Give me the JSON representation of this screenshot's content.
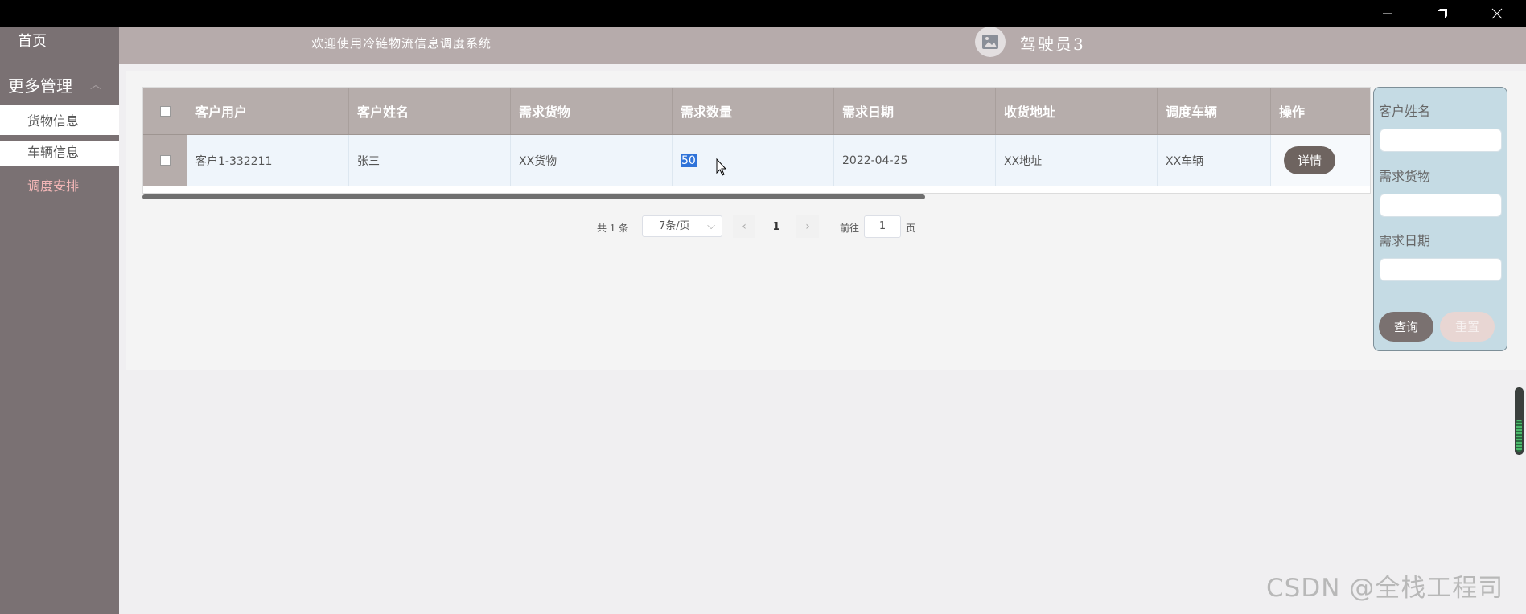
{
  "window": {
    "minimize_icon": "minimize-icon",
    "restore_icon": "restore-icon",
    "close_icon": "close-icon"
  },
  "sidebar": {
    "home": "首页",
    "group": "更多管理",
    "items": [
      {
        "label": "货物信息"
      },
      {
        "label": "车辆信息"
      },
      {
        "label": "调度安排",
        "active": true
      }
    ]
  },
  "header": {
    "welcome": "欢迎使用冷链物流信息调度系统",
    "user": "驾驶员3",
    "avatar_icon": "image-icon"
  },
  "table": {
    "columns": [
      "客户用户",
      "客户姓名",
      "需求货物",
      "需求数量",
      "需求日期",
      "收货地址",
      "调度车辆",
      "操作"
    ],
    "rows": [
      {
        "customer_user": "客户1-332211",
        "customer_name": "张三",
        "goods": "XX货物",
        "quantity": "50",
        "date": "2022-04-25",
        "address": "XX地址",
        "vehicle": "XX车辆",
        "action": "详情"
      }
    ]
  },
  "pagination": {
    "total": "共 1 条",
    "page_size": "7条/页",
    "current_page": "1",
    "goto_label": "前往",
    "goto_value": "1",
    "goto_unit": "页"
  },
  "search": {
    "customer_name_label": "客户姓名",
    "goods_label": "需求货物",
    "date_label": "需求日期",
    "customer_name_value": "",
    "goods_value": "",
    "date_value": "",
    "query_button": "查询",
    "reset_button": "重置"
  },
  "watermark": "CSDN @全栈工程司",
  "colors": {
    "sidebar": "#7a7173",
    "header": "#b6abab",
    "table_header": "#b6adab",
    "row": "#eff5fb",
    "search_panel": "#c5dbe4",
    "active_item": "#f2b6b6"
  }
}
